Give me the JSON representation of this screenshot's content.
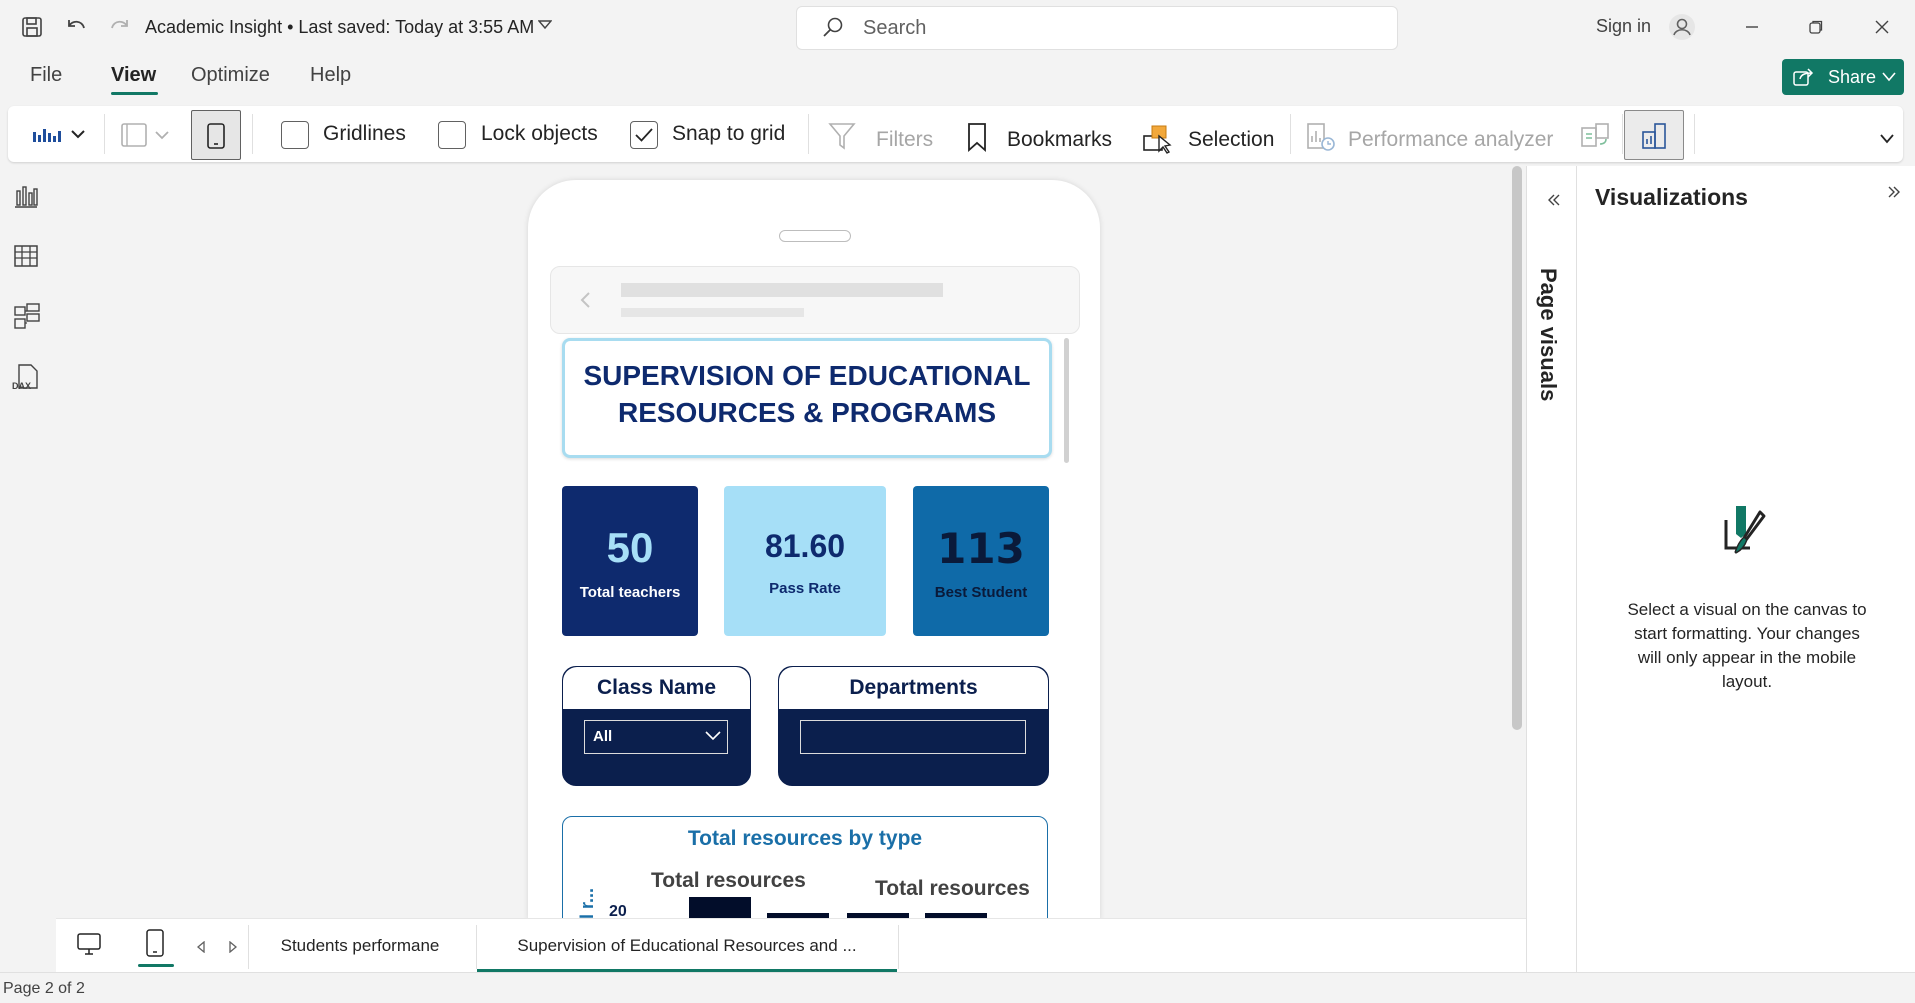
{
  "titlebar": {
    "doc_title": "Academic Insight • Last saved: Today at 3:55 AM",
    "search_placeholder": "Search",
    "sign_in": "Sign in"
  },
  "menu": {
    "items": [
      "File",
      "View",
      "Optimize",
      "Help"
    ],
    "active": "View",
    "share_label": "Share"
  },
  "ribbon": {
    "gridlines": "Gridlines",
    "lock_objects": "Lock objects",
    "snap_to_grid": "Snap to grid",
    "filters": "Filters",
    "bookmarks": "Bookmarks",
    "selection": "Selection",
    "performance_analyzer": "Performance analyzer"
  },
  "report": {
    "title": "SUPERVISION OF EDUCATIONAL RESOURCES & PROGRAMS",
    "kpis": [
      {
        "value": "50",
        "label": "Total teachers"
      },
      {
        "value": "81.60",
        "label": "Pass Rate"
      },
      {
        "value": "113",
        "label": "Best Student"
      }
    ],
    "slicers": [
      {
        "title": "Class Name",
        "value": "All"
      },
      {
        "title": "Departments",
        "value": ""
      }
    ],
    "chart": {
      "title": "Total resources by type",
      "y_label_clipped": "al r...",
      "legend_left": "Total resources",
      "legend_right": "Total resources",
      "tick": "20"
    }
  },
  "page_visuals_label": "Page visuals",
  "visualizations": {
    "title": "Visualizations",
    "message": "Select a visual on the canvas to start formatting. Your changes will only appear in the mobile layout."
  },
  "tabs": [
    {
      "label": "Students performane",
      "active": false
    },
    {
      "label": "Supervision of Educational Resources and ...",
      "active": true
    }
  ],
  "status": {
    "page": "Page 2 of 2"
  },
  "colors": {
    "accent": "#117865",
    "navy": "#0b1f4d",
    "kpi1": "#0e2a6e",
    "kpi2": "#a6dff7",
    "kpi3": "#0f6aa8"
  }
}
